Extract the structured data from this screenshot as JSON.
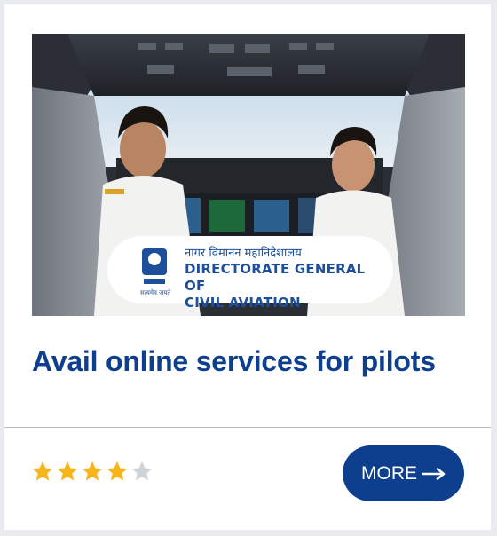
{
  "card": {
    "image": {
      "logo": {
        "hindi_text": "नागर विमानन महानिदेशालय",
        "line1": "DIRECTORATE GENERAL OF",
        "line2": "CIVIL AVIATION",
        "emblem_caption": "सत्यमेव जयते"
      }
    },
    "title": "Avail online services for pilots",
    "rating": {
      "value": 4,
      "max": 5,
      "filled_color": "#f7b51b",
      "empty_color": "#cfd2d6"
    },
    "more_button": {
      "label": "MORE",
      "icon": "arrow-right-icon",
      "color": "#0e3f8f"
    }
  }
}
